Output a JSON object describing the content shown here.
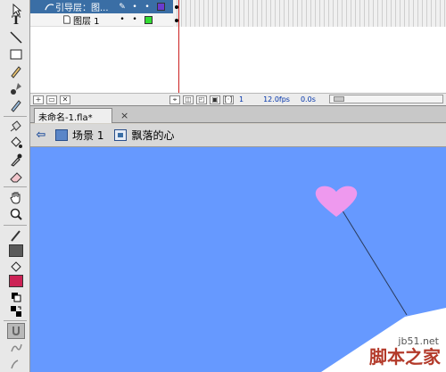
{
  "timeline": {
    "layers": [
      {
        "name": "引导层：图...",
        "type": "guide",
        "color": "#6a3ccf"
      },
      {
        "name": "图层 1",
        "type": "normal",
        "color": "#33dd33"
      }
    ],
    "status": {
      "current_frame": "1",
      "fps": "12.0fps",
      "time": "0.0s"
    }
  },
  "tabs": {
    "doc_tab_label": "未命名-1.fla*",
    "close_glyph": "×"
  },
  "editbar": {
    "back_glyph": "⇦",
    "scene_label": "场景 1",
    "symbol_label": "飘落的心"
  },
  "toolbar": {
    "stroke_color": "#5a5a5a",
    "fill_color": "#cc2255"
  },
  "stage": {
    "background": "#6699ff",
    "heart_color": "#ee99ee"
  },
  "watermark": {
    "site": "jb51.net",
    "brand": "脚本之家"
  }
}
